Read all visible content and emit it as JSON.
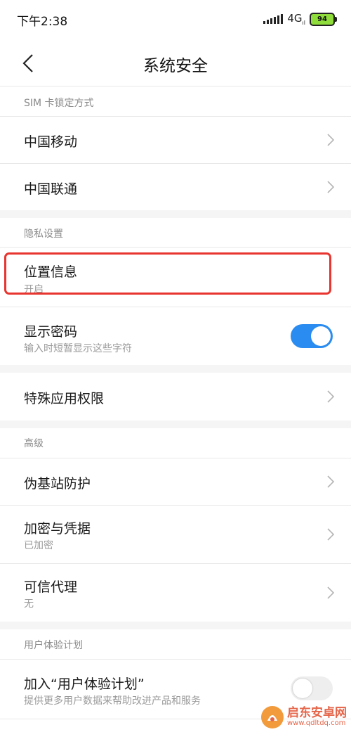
{
  "status_bar": {
    "time": "下午2:38",
    "network": "4G",
    "network_sub": "ıl",
    "battery": "94"
  },
  "header": {
    "title": "系统安全"
  },
  "sections": {
    "sim_lock": {
      "label": "SIM 卡锁定方式",
      "items": [
        {
          "title": "中国移动"
        },
        {
          "title": "中国联通"
        }
      ]
    },
    "privacy": {
      "label": "隐私设置",
      "location": {
        "title": "位置信息",
        "subtitle": "开启"
      },
      "show_password": {
        "title": "显示密码",
        "subtitle": "输入时短暂显示这些字符",
        "enabled": true
      }
    },
    "special_access": {
      "title": "特殊应用权限"
    },
    "advanced": {
      "label": "高级",
      "items": [
        {
          "title": "伪基站防护",
          "subtitle": ""
        },
        {
          "title": "加密与凭据",
          "subtitle": "已加密"
        },
        {
          "title": "可信代理",
          "subtitle": "无"
        }
      ]
    },
    "ux_plan": {
      "label": "用户体验计划",
      "join": {
        "title": "加入“用户体验计划”",
        "subtitle": "提供更多用户数据来帮助改进产品和服务",
        "enabled": false
      }
    }
  },
  "watermark": {
    "name": "启东安卓网",
    "url": "www.qdltdq.com"
  },
  "colors": {
    "accent": "#2a8cf0",
    "highlight": "#e8352f",
    "section_bg": "#f5f5f5"
  }
}
